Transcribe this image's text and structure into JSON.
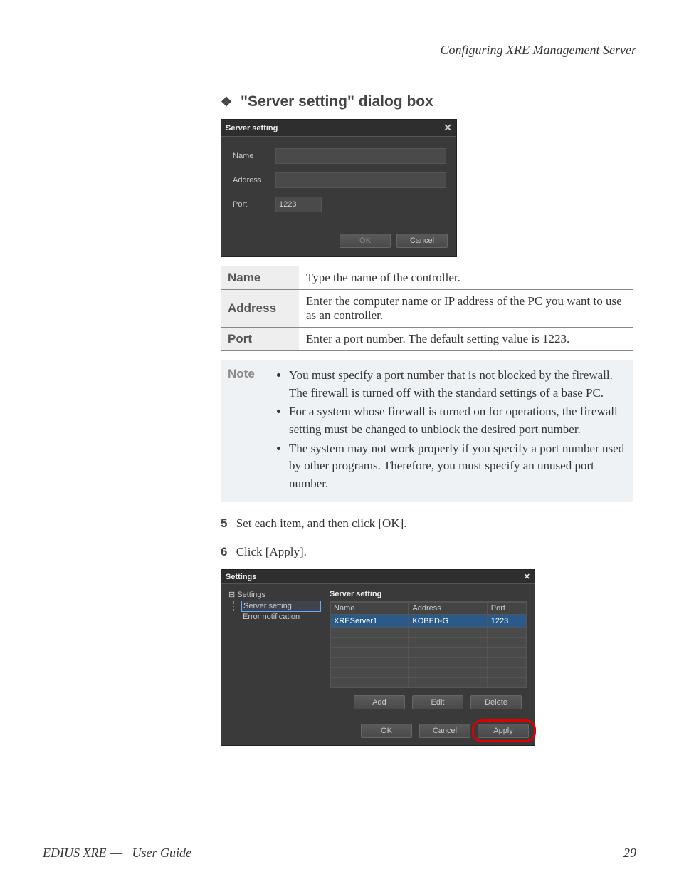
{
  "header_right": "Configuring XRE Management Server",
  "section_title": "\"Server setting\" dialog box",
  "dialog1": {
    "title": "Server setting",
    "name_label": "Name",
    "name_value": "",
    "address_label": "Address",
    "address_value": "",
    "port_label": "Port",
    "port_value": "1223",
    "ok": "OK",
    "cancel": "Cancel"
  },
  "desc_table": {
    "rows": [
      {
        "label": "Name",
        "text": "Type the name of the controller."
      },
      {
        "label": "Address",
        "text": "Enter the computer name or IP address of the PC you want to use as an controller."
      },
      {
        "label": "Port",
        "text": "Enter a port number. The default setting value is 1223."
      }
    ]
  },
  "note": {
    "label": "Note",
    "items": [
      "You must specify a port number that is not blocked by the firewall. The firewall is turned off with the standard settings of a base PC.",
      "For a system whose firewall is turned on for operations, the firewall setting must be changed to unblock the desired port number.",
      "The system may not work properly if you specify a port number used by other programs. Therefore, you must specify an unused port number."
    ]
  },
  "step5": {
    "num": "5",
    "text": "Set each item, and then click [OK]."
  },
  "step6": {
    "num": "6",
    "text": "Click [Apply]."
  },
  "dialog2": {
    "title": "Settings",
    "tree_root": "Settings",
    "tree_child1": "Server setting",
    "tree_child2": "Error notification",
    "panel_title": "Server setting",
    "col1": "Name",
    "col2": "Address",
    "col3": "Port",
    "row1_c1": "XREServer1",
    "row1_c2": "KOBED-G",
    "row1_c3": "1223",
    "add": "Add",
    "edit": "Edit",
    "delete": "Delete",
    "ok": "OK",
    "cancel": "Cancel",
    "apply": "Apply"
  },
  "footer": {
    "left1": "EDIUS XRE",
    "left2": "—",
    "left3": "User Guide",
    "page": "29"
  }
}
